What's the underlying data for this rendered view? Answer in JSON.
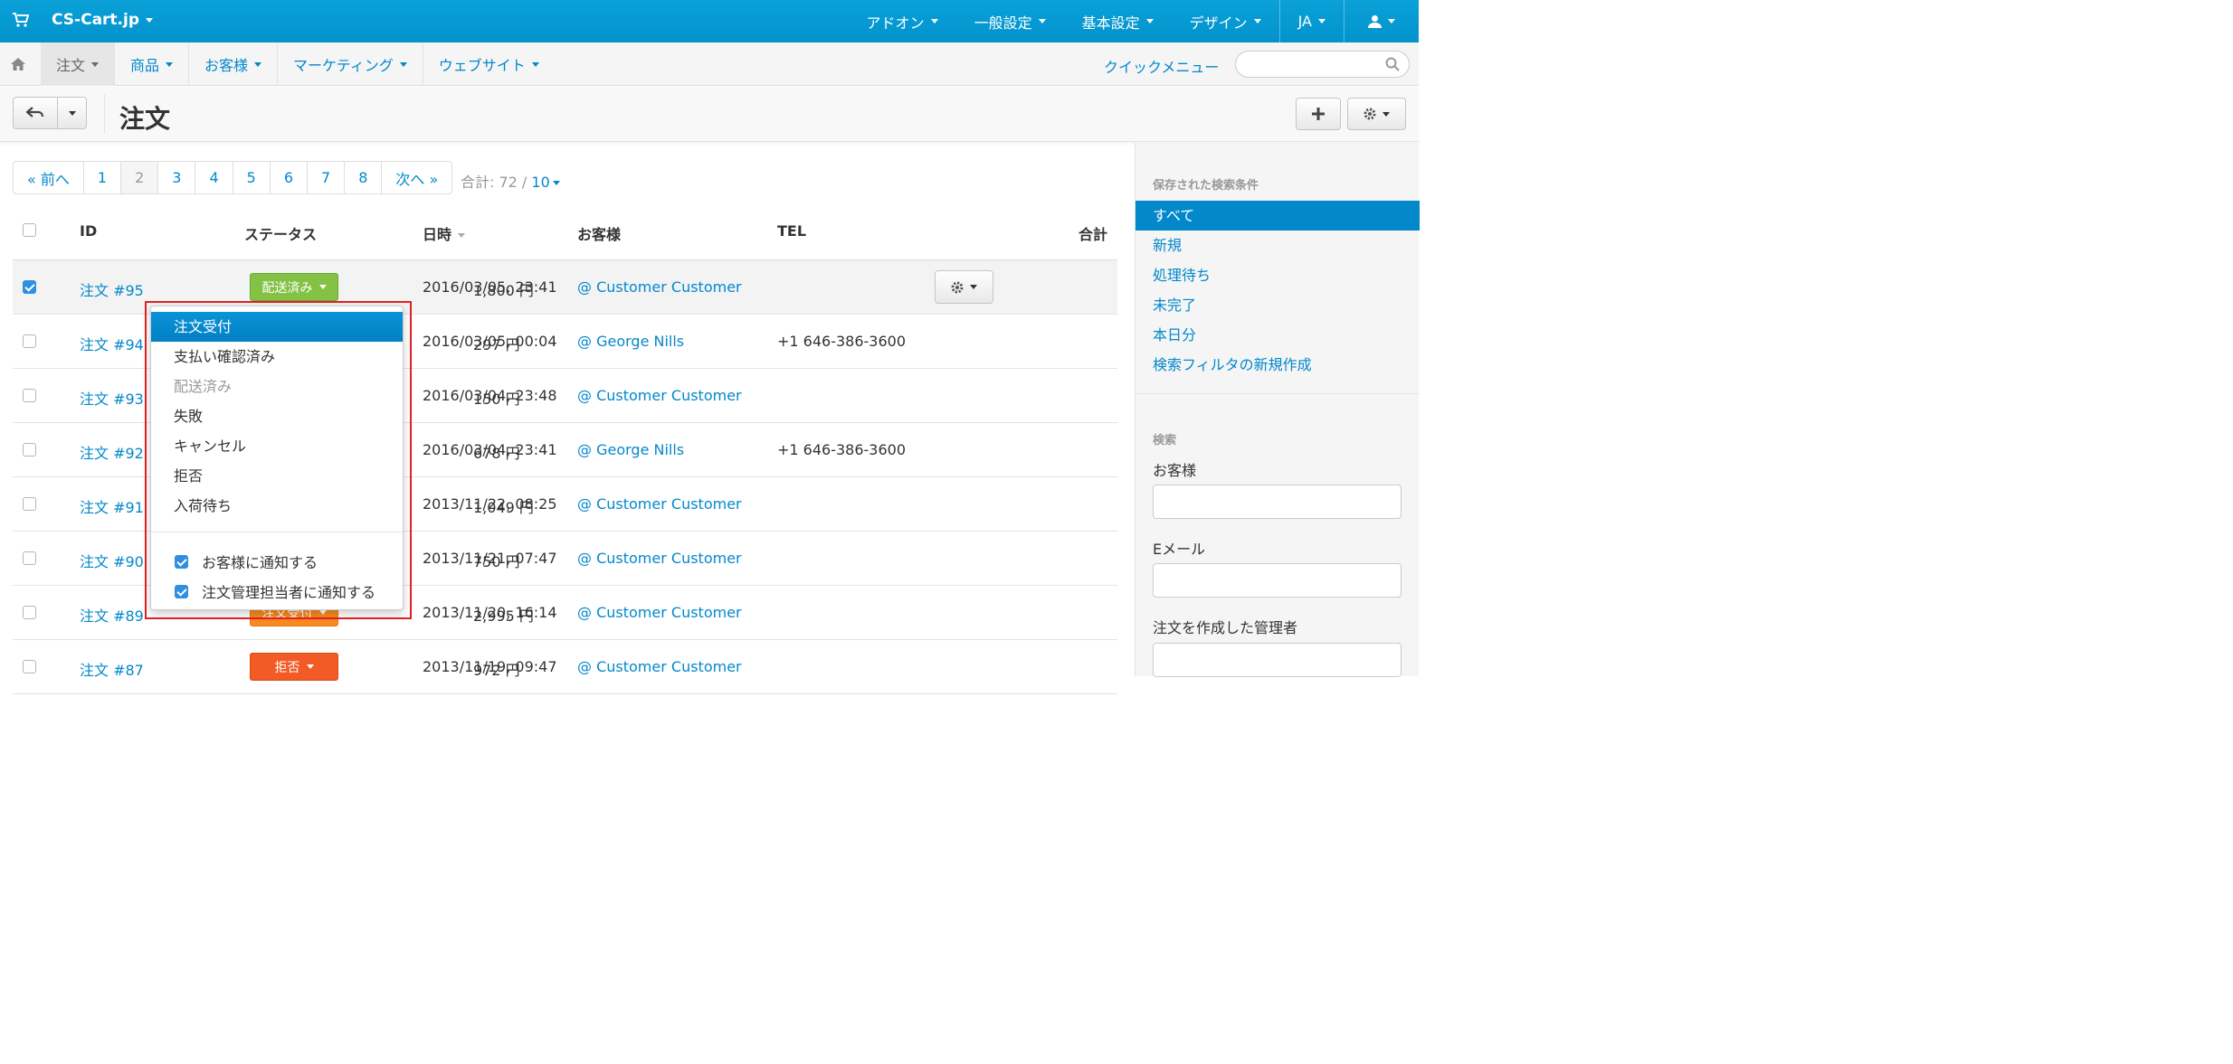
{
  "topbar": {
    "brand": "CS-Cart.jp",
    "nav": [
      "アドオン",
      "一般設定",
      "基本設定",
      "デザイン",
      "JA"
    ],
    "icons": [
      "cart-icon",
      "user-icon"
    ]
  },
  "subnav": {
    "menu": [
      "注文",
      "商品",
      "お客様",
      "マーケティング",
      "ウェブサイト"
    ],
    "quick_menu": "クイックメニュー",
    "search_placeholder": ""
  },
  "header": {
    "title": "注文"
  },
  "pagination": {
    "prev": "« 前へ",
    "pages": [
      "1",
      "2",
      "3",
      "4",
      "5",
      "6",
      "7",
      "8"
    ],
    "current": "2",
    "next": "次へ »",
    "total_label": "合計: 72 /",
    "per_page": "10"
  },
  "table": {
    "headers": {
      "id": "ID",
      "status": "ステータス",
      "date": "日時",
      "customer": "お客様",
      "tel": "TEL",
      "total": "合計"
    },
    "rows": [
      {
        "id": "注文 #95",
        "status": "配送済み",
        "status_color": "#84c246",
        "date": "2016/03/05, 23:41",
        "customer": "@ Customer Customer",
        "tel": "",
        "total": "1,800 円",
        "checked": true
      },
      {
        "id": "注文 #94",
        "status": "",
        "status_color": "",
        "date": "2016/03/05, 00:04",
        "customer": "@ George Nills",
        "tel": "+1 646-386-3600",
        "total": "297 円",
        "checked": false
      },
      {
        "id": "注文 #93",
        "status": "",
        "status_color": "",
        "date": "2016/03/04, 23:48",
        "customer": "@ Customer Customer",
        "tel": "",
        "total": "150 円",
        "checked": false
      },
      {
        "id": "注文 #92",
        "status": "",
        "status_color": "",
        "date": "2016/03/04, 23:41",
        "customer": "@ George Nills",
        "tel": "+1 646-386-3600",
        "total": "678 円",
        "checked": false
      },
      {
        "id": "注文 #91",
        "status": "",
        "status_color": "",
        "date": "2013/11/22, 08:25",
        "customer": "@ Customer Customer",
        "tel": "",
        "total": "1,049 円",
        "checked": false
      },
      {
        "id": "注文 #90",
        "status": "",
        "status_color": "",
        "date": "2013/11/21, 07:47",
        "customer": "@ Customer Customer",
        "tel": "",
        "total": "750 円",
        "checked": false
      },
      {
        "id": "注文 #89",
        "status": "注文受付",
        "status_color": "#f88a20",
        "date": "2013/11/20, 16:14",
        "customer": "@ Customer Customer",
        "tel": "",
        "total": "2,995 円",
        "checked": false
      },
      {
        "id": "注文 #87",
        "status": "拒否",
        "status_color": "#f25a26",
        "date": "2013/11/19, 09:47",
        "customer": "@ Customer Customer",
        "tel": "",
        "total": "972 円",
        "checked": false
      }
    ]
  },
  "status_dropdown": {
    "options": [
      "注文受付",
      "支払い確認済み",
      "配送済み",
      "失敗",
      "キャンセル",
      "拒否",
      "入荷待ち"
    ],
    "highlighted": "注文受付",
    "disabled": "配送済み",
    "notify_customer": "お客様に通知する",
    "notify_admin": "注文管理担当者に通知する"
  },
  "sidebar": {
    "saved_title": "保存された検索条件",
    "saved": [
      "すべて",
      "新規",
      "処理待ち",
      "未完了",
      "本日分",
      "検索フィルタの新規作成"
    ],
    "search_title": "検索",
    "fields": [
      "お客様",
      "Eメール",
      "注文を作成した管理者"
    ]
  },
  "colors": {
    "topbar": "#0aa1d8",
    "link": "#0388cc",
    "highlight_box": "#e02020"
  }
}
